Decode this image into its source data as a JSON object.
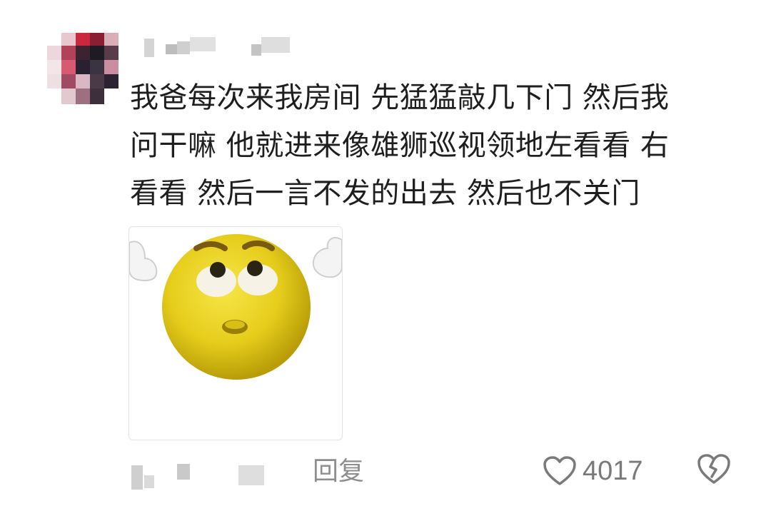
{
  "comment": {
    "text_lines": [
      "我爸每次来我房间 先猛猛敲几下门 然后我",
      "问干嘛 他就进来像雄狮巡视领地左看看 右",
      "看看 然后一言不发的出去 然后也不关门"
    ]
  },
  "actions": {
    "reply_label": "回复",
    "like_count": "4017"
  },
  "icons": {
    "like": "heart-outline-icon",
    "dislike": "broken-heart-icon"
  },
  "colors": {
    "text": "#1e1e1e",
    "muted": "#8e8e8e",
    "sticker_face": "#e8cf1f"
  }
}
